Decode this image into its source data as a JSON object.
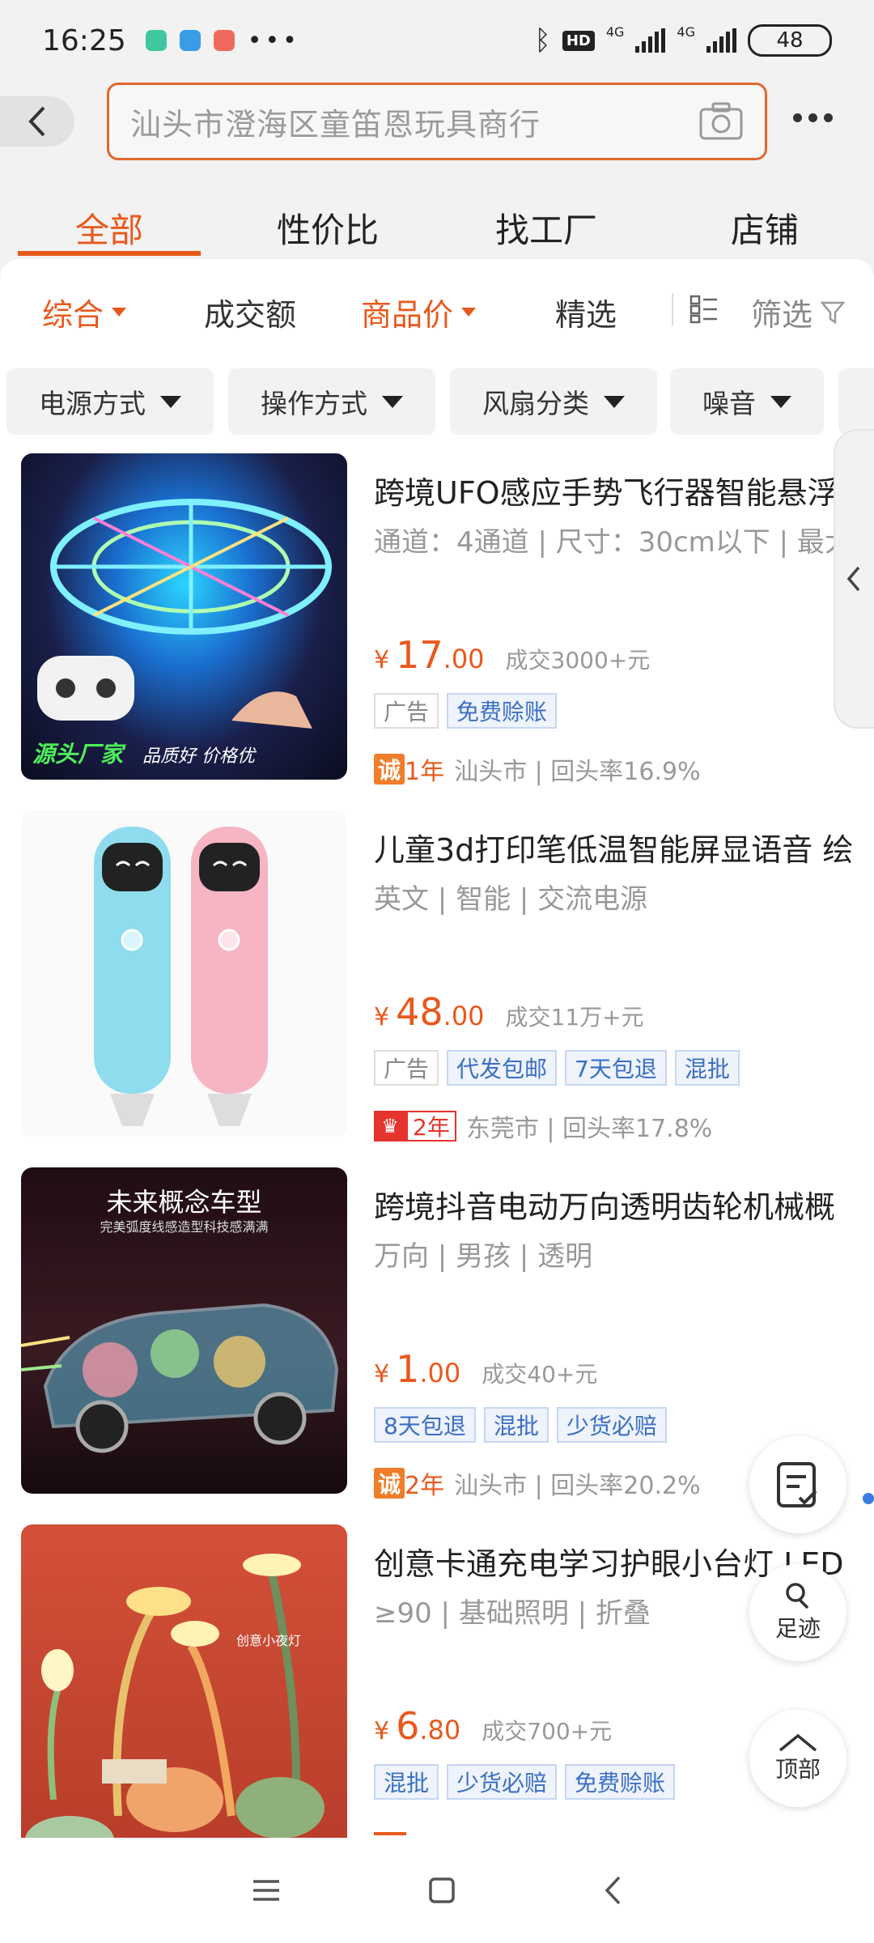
{
  "status_bar": {
    "time": "16:25",
    "network1": "4G",
    "network2": "4G",
    "hd": "HD",
    "battery": "48"
  },
  "search": {
    "placeholder": "汕头市澄海区童笛恩玩具商行"
  },
  "tabs": [
    {
      "label": "全部",
      "active": true
    },
    {
      "label": "性价比",
      "active": false
    },
    {
      "label": "找工厂",
      "active": false
    },
    {
      "label": "店铺",
      "active": false
    }
  ],
  "sort": {
    "comprehensive": "综合",
    "turnover": "成交额",
    "price": "商品价",
    "selected": "精选",
    "filter": "筛选"
  },
  "filters": [
    "电源方式",
    "操作方式",
    "风扇分类",
    "噪音"
  ],
  "products": [
    {
      "title": "跨境UFO感应手势飞行器智能悬浮",
      "attrs": "通道：4通道 | 尺寸：30cm以下 | 最大",
      "price_int": "17",
      "price_dec": ".00",
      "currency": "¥",
      "sales": "成交3000+元",
      "tags": [
        "广告",
        "免费赊账"
      ],
      "badge": "诚",
      "years": "1年",
      "seller": "汕头市 | 回头率16.9%",
      "img_text1": "源头厂家",
      "img_text2": "品质好 价格优"
    },
    {
      "title": "儿童3d打印笔低温智能屏显语音 绘",
      "attrs": "英文 | 智能 | 交流电源",
      "price_int": "48",
      "price_dec": ".00",
      "currency": "¥",
      "sales": "成交11万+元",
      "tags": [
        "广告",
        "代发包邮",
        "7天包退",
        "混批"
      ],
      "years": "2年",
      "seller": "东莞市 | 回头率17.8%"
    },
    {
      "title": "跨境抖音电动万向透明齿轮机械概",
      "attrs": "万向 | 男孩 | 透明",
      "price_int": "1",
      "price_dec": ".00",
      "currency": "¥",
      "sales": "成交40+元",
      "tags": [
        "8天包退",
        "混批",
        "少货必赔"
      ],
      "badge": "诚",
      "years": "2年",
      "seller": "汕头市 | 回头率20.2%",
      "img_text1": "未来概念车型",
      "img_text2": "完美弧度线感造型科技感满满"
    },
    {
      "title": "创意卡通充电学习护眼小台灯 LED",
      "attrs": "≥90 | 基础照明 | 折叠",
      "price_int": "6",
      "price_dec": ".80",
      "currency": "¥",
      "sales": "成交700+元",
      "tags": [
        "混批",
        "少货必赔",
        "免费赊账"
      ],
      "img_text1": "创意小夜灯"
    }
  ],
  "float": {
    "footprint": "足迹",
    "top": "顶部"
  },
  "colors": {
    "accent": "#e8591c",
    "tag_blue": "#3a6fc4"
  }
}
